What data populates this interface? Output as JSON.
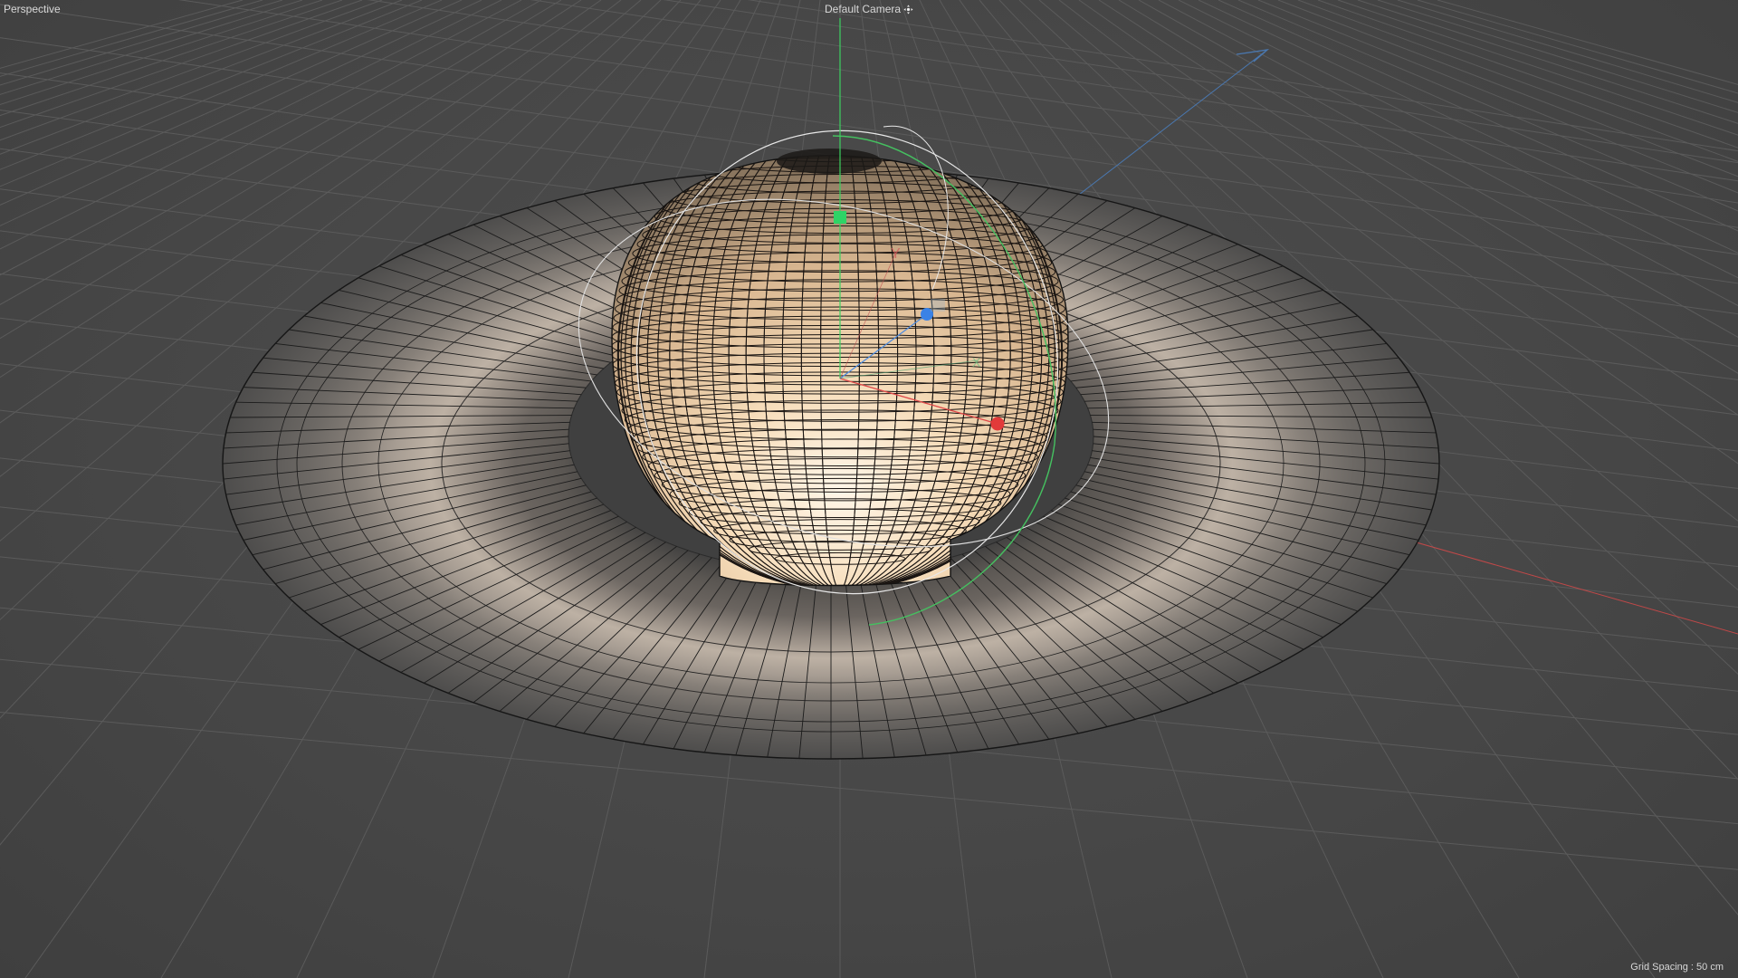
{
  "viewport": {
    "view_name": "Perspective",
    "camera_name": "Default Camera",
    "camera_icon": "camera-move-icon",
    "grid_spacing": "Grid Spacing : 50 cm"
  },
  "colors": {
    "background": "#4a4a4a",
    "grid_line": "#5d5d5d",
    "axis_x": "#d84040",
    "axis_y": "#3cd060",
    "axis_z": "#3c7cd8",
    "planet": "#f4d7b2",
    "wireframe": "#161616",
    "ring_light": "#b9ada0",
    "ring_dark": "#6e6a66"
  },
  "scene": {
    "object": "saturn-planet-with-rings",
    "gizmo": "rotate-move-manipulator"
  }
}
